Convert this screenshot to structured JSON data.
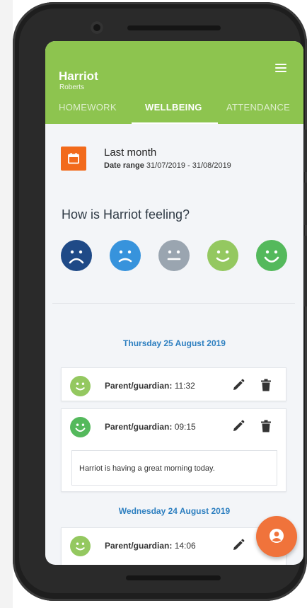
{
  "header": {
    "first_name": "Harriot",
    "last_name": "Roberts",
    "menu_icon": "hamburger-menu-icon",
    "background": "#8dc44f"
  },
  "tabs": [
    {
      "label": "HOMEWORK",
      "active": false
    },
    {
      "label": "WELLBEING",
      "active": true
    },
    {
      "label": "ATTENDANCE",
      "active": false
    }
  ],
  "date_filter": {
    "icon": "calendar-icon",
    "button_color": "#f26a1b",
    "title": "Last month",
    "range_label": "Date range",
    "range_value": "31/07/2019 - 31/08/2019"
  },
  "question": "How is Harriot feeling?",
  "moods": [
    {
      "name": "very-sad",
      "color": "#1f4a87"
    },
    {
      "name": "sad",
      "color": "#3793dc"
    },
    {
      "name": "neutral",
      "color": "#9aa5b0"
    },
    {
      "name": "happy",
      "color": "#94c860"
    },
    {
      "name": "very-happy",
      "color": "#54b95c"
    }
  ],
  "days": [
    {
      "date": "Thursday 25 August 2019",
      "entries": [
        {
          "author": "Parent/guardian:",
          "time": "11:32",
          "face_color": "#94c860",
          "note": ""
        },
        {
          "author": "Parent/guardian:",
          "time": "09:15",
          "face_color": "#54b95c",
          "note": "Harriot is having a great morning today."
        }
      ]
    },
    {
      "date": "Wednesday 24 August 2019",
      "entries": [
        {
          "author": "Parent/guardian:",
          "time": "14:06",
          "face_color": "#94c860",
          "note": ""
        }
      ]
    }
  ],
  "fab": {
    "icon": "person-icon",
    "color": "#f0733b"
  },
  "colors": {
    "accent": "#8dc44f",
    "date_heading": "#2d7fc0",
    "screen_bg": "#f3f5f8"
  }
}
